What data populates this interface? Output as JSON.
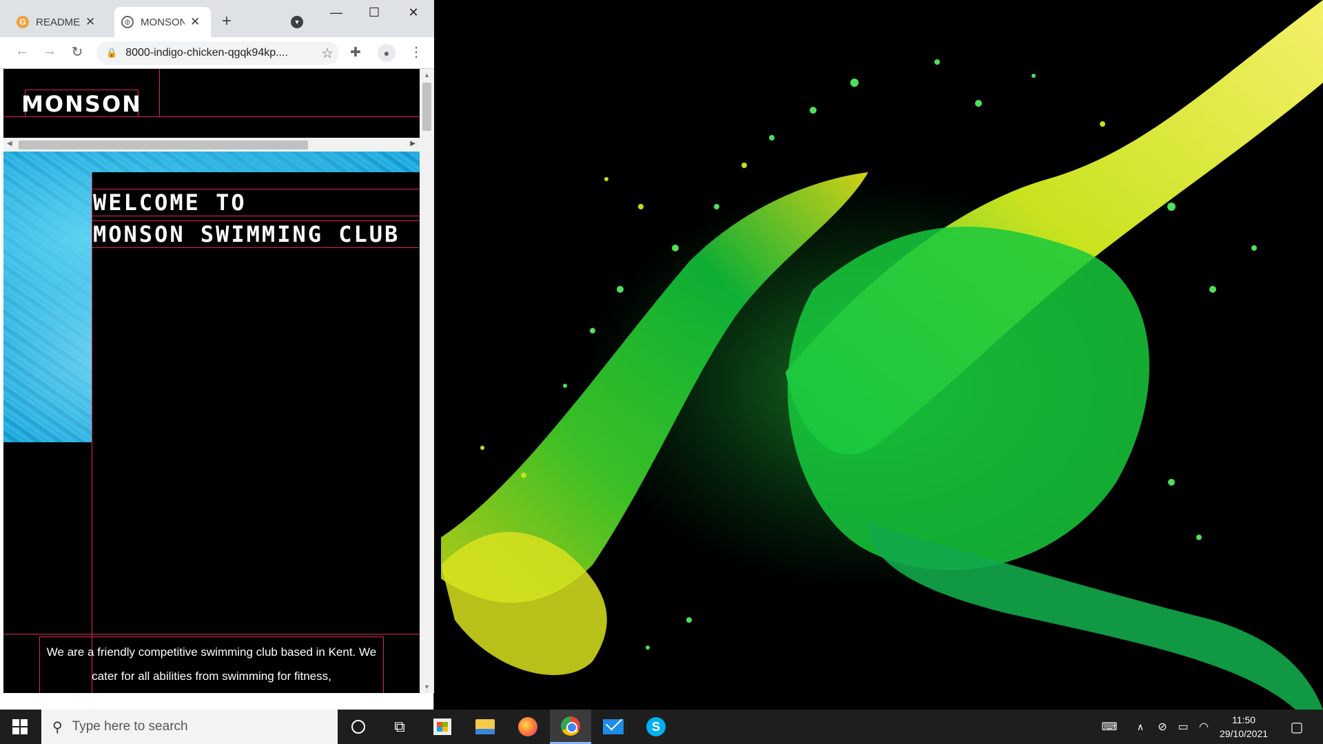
{
  "browser": {
    "tabs": [
      {
        "title": "README",
        "icon": "g-favicon",
        "active": false
      },
      {
        "title": "MONSON",
        "icon": "globe-favicon",
        "active": true
      }
    ],
    "url": "8000-indigo-chicken-qgqk94kp....",
    "window_controls": {
      "minimize": "—",
      "maximize": "☐",
      "close": "✕"
    }
  },
  "site": {
    "logo": "MONSON",
    "hero_line_1": "WELCOME TO",
    "hero_line_2": "MONSON SWIMMING CLUB",
    "intro_text": "We are a friendly competitive swimming club based in Kent. We cater for all abilities from swimming for fitness,"
  },
  "taskbar": {
    "search_placeholder": "Type here to search",
    "time": "11:50",
    "date": "29/10/2021",
    "pinned": [
      "cortana",
      "task-view",
      "microsoft-store",
      "file-explorer",
      "firefox",
      "chrome",
      "mail",
      "skype"
    ]
  },
  "colors": {
    "accent_border": "#e0245e",
    "wallpaper_background": "#000000",
    "splash_green": "#1fd13a",
    "splash_yellow": "#e6e61a"
  }
}
